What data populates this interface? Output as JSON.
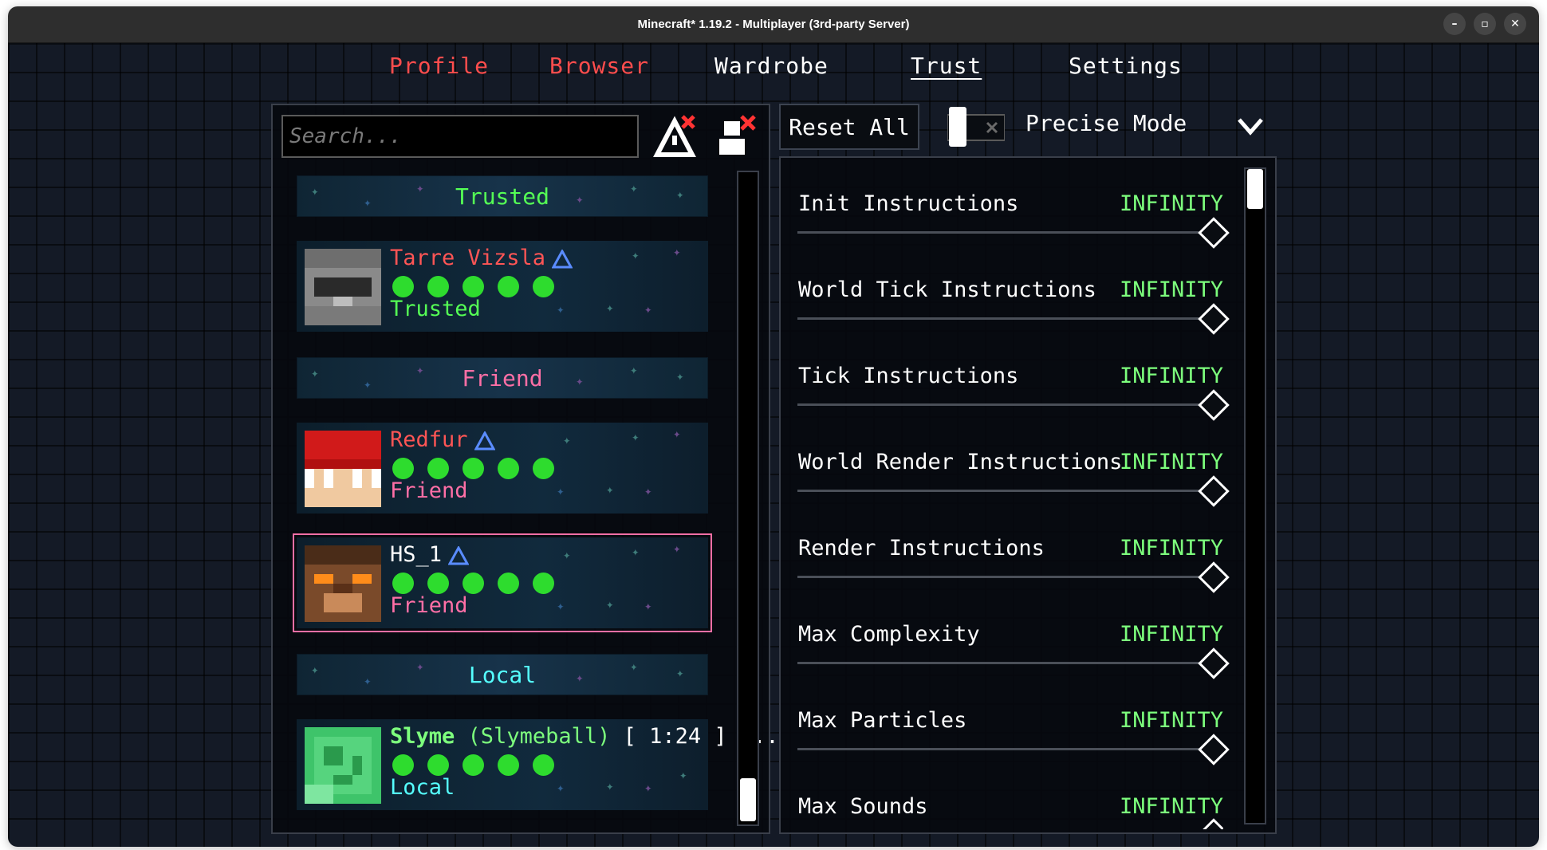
{
  "window": {
    "title": "Minecraft* 1.19.2 - Multiplayer (3rd-party Server)",
    "controls": {
      "minimize": "–",
      "maximize": "▫",
      "close": "✕"
    }
  },
  "tabs": [
    {
      "label": "Profile",
      "color": "#ff4d4d"
    },
    {
      "label": "Browser",
      "color": "#ff4d4d"
    },
    {
      "label": "Wardrobe",
      "color": "#ffffff"
    },
    {
      "label": "Trust",
      "color": "#ffffff",
      "active": true
    },
    {
      "label": "Settings",
      "color": "#ffffff"
    }
  ],
  "left": {
    "search_placeholder": "Search...",
    "groups": {
      "trusted": {
        "label": "Trusted",
        "color": "#55ff55"
      },
      "friend": {
        "label": "Friend",
        "color": "#ff6fa6"
      },
      "local": {
        "label": "Local",
        "color": "#55ffff"
      }
    },
    "players": [
      {
        "name": "Tarre Vizsla",
        "status": "Trusted",
        "name_color": "#ff5555",
        "status_color": "#55ff55",
        "dots": 5
      },
      {
        "name": "Redfur",
        "status": "Friend",
        "name_color": "#ff5555",
        "status_color": "#ff6fa6",
        "dots": 5
      },
      {
        "name": "HS_1",
        "status": "Friend",
        "name_color": "#ffffff",
        "status_color": "#ff6fa6",
        "dots": 5,
        "selected": true
      },
      {
        "name": "Slyme",
        "nickname": "(Slymeball)",
        "time": "[ 1:24 ] ...",
        "status": "Local",
        "name_color": "#7dff7d",
        "status_color": "#55ffff",
        "dots": 5
      }
    ]
  },
  "right": {
    "reset_label": "Reset All",
    "precise_label": "Precise Mode",
    "settings": [
      {
        "name": "Init Instructions",
        "value": "INFINITY"
      },
      {
        "name": "World Tick Instructions",
        "value": "INFINITY"
      },
      {
        "name": "Tick Instructions",
        "value": "INFINITY"
      },
      {
        "name": "World Render Instructions",
        "value": "INFINITY"
      },
      {
        "name": "Render Instructions",
        "value": "INFINITY"
      },
      {
        "name": "Max Complexity",
        "value": "INFINITY"
      },
      {
        "name": "Max Particles",
        "value": "INFINITY"
      },
      {
        "name": "Max Sounds",
        "value": "INFINITY"
      }
    ]
  }
}
